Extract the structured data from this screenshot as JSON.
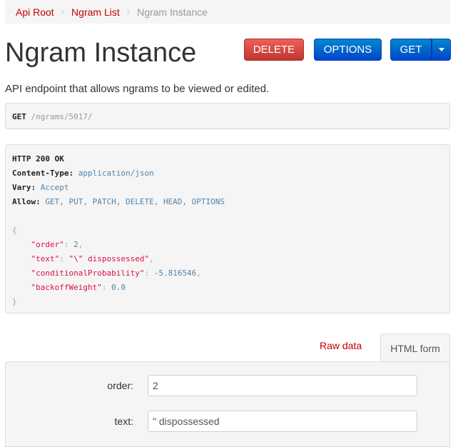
{
  "breadcrumb": {
    "items": [
      "Api Root",
      "Ngram List"
    ],
    "separator": "›",
    "active": "Ngram Instance"
  },
  "page": {
    "title": "Ngram Instance",
    "description": "API endpoint that allows ngrams to be viewed or edited."
  },
  "buttons": {
    "delete": "DELETE",
    "options": "OPTIONS",
    "get": "GET"
  },
  "request": {
    "method": "GET",
    "path": "/ngrams/5017/"
  },
  "response": {
    "status": "HTTP 200 OK",
    "headers": [
      {
        "name": "Content-Type",
        "value": "application/json"
      },
      {
        "name": "Vary",
        "value": "Accept"
      },
      {
        "name": "Allow",
        "value": "GET, PUT, PATCH, DELETE, HEAD, OPTIONS"
      }
    ],
    "open_brace": "{",
    "close_brace": "}",
    "fields": [
      {
        "key": "\"order\"",
        "value": "2",
        "kind": "num",
        "comma": ","
      },
      {
        "key": "\"text\"",
        "value": "\"\\\" dispossessed\"",
        "kind": "str",
        "comma": ","
      },
      {
        "key": "\"conditionalProbability\"",
        "value": "-5.816546",
        "kind": "num",
        "comma": ","
      },
      {
        "key": "\"backoffWeight\"",
        "value": "0.0",
        "kind": "num",
        "comma": ""
      }
    ]
  },
  "tabs": {
    "raw": "Raw data",
    "html": "HTML form"
  },
  "form": {
    "order": {
      "label": "order:",
      "value": "2"
    },
    "text": {
      "label": "text:",
      "value": "\" dispossessed"
    }
  },
  "colors": {
    "link": "#c20000",
    "delete": "#da4f49",
    "primary": "#006dcc",
    "well": "#f5f5f5"
  }
}
